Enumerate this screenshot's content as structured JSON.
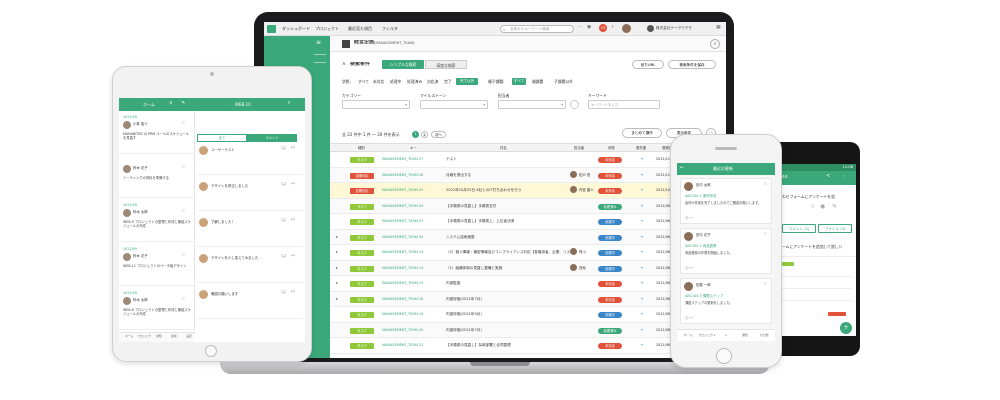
{
  "colors": {
    "brand": "#3aa87a",
    "tag": "#8fc93a",
    "red": "#e0533a",
    "blue": "#3a86c8",
    "highlight": "#fff8d6"
  },
  "laptop": {
    "nav": [
      "ダッシュボード",
      "プロジェクト",
      "最近見た項目",
      "フィルタ"
    ],
    "search_placeholder": "全体からキーワード検索",
    "notif_count": "15",
    "company": "株式会社テーラワデモ",
    "project_title": "経営企画",
    "project_code": "(MANAGEMENT_TEAM)",
    "search_section": "検索条件",
    "simple_tab": "シンプルな検索",
    "advanced_tab": "高度な検索",
    "share_btn": "絞りURL",
    "save_btn": "検索条件を保存",
    "status_label": "状態:",
    "status_opts": [
      "すべて",
      "未対応",
      "処理中",
      "処理済み",
      "対応済",
      "完了",
      "完了以外"
    ],
    "parent_label": "親子課題:",
    "parent_opts": [
      "すべて",
      "親課題",
      "子課題以外"
    ],
    "filters": [
      "カテゴリー",
      "マイルストーン",
      "担当者",
      "キーワード"
    ],
    "keyword_placeholder": "キーワードを入力",
    "result_text": "全 22 件中 1 件 〜 20 件を表示",
    "pages": [
      "1",
      "2",
      "次へ"
    ],
    "bulk_btn": "まとめて操作",
    "display_btn": "表示設定",
    "columns": [
      "種別",
      "キー",
      "件名",
      "担当者",
      "状態",
      "優先度",
      "登録日",
      "期限日",
      "更新日"
    ],
    "rows": [
      {
        "type": "タスク",
        "key": "MANAGEMENT_TEAM-27",
        "subject": "テスト",
        "assignee": "",
        "status": "未対応",
        "prio": "→",
        "date": "2021/11/02",
        "due": "",
        "updated": ""
      },
      {
        "type": "定期対応",
        "key": "MANAGEMENT_TEAM-26",
        "subject": "月報を提出する",
        "assignee": "松戸 悠",
        "status": "未対応",
        "prio": "→",
        "date": "2021/11/02",
        "due": "2021/10/31",
        "updated": "2021/"
      },
      {
        "type": "定期対応",
        "key": "MANAGEMENT_TEAM-25",
        "subject": "2021年10月25日 A社とのIT打ち合わせを行う",
        "assignee": "内室 裏人",
        "status": "未対応",
        "prio": "→",
        "date": "2021/10/22",
        "due": "2021/10/25",
        "updated": "2021/"
      },
      {
        "type": "タスク",
        "key": "MANAGEMENT_TEAM-24",
        "subject": "【手順書の見直し】手順書支付",
        "assignee": "",
        "status": "処理済み",
        "prio": "→",
        "date": "2021/08/20",
        "due": "2022/01/01",
        "updated": "2021/"
      },
      {
        "type": "タスク",
        "key": "MANAGEMENT_TEAM-23",
        "subject": "【手順書の見直し】手順書上、上位者決済",
        "assignee": "",
        "status": "処理中",
        "prio": "→",
        "date": "2021/08/20",
        "due": "2021/08/20",
        "updated": "2021/"
      },
      {
        "type": "タスク",
        "key": "MANAGEMENT_TEAM-34",
        "subject": "システム技術面整",
        "assignee": "",
        "status": "処理中",
        "prio": "→",
        "date": "2021/08/20",
        "due": "2021/08/20",
        "updated": "2021/"
      },
      {
        "type": "タスク",
        "key": "MANAGEMENT_TEAM-13",
        "subject": "（2）個人情報・機密情報及びコンプライアンス対応【各機用者、企業、リスク対策等、研修】（通年実施）",
        "assignee": "阿川",
        "status": "処理中",
        "prio": "→",
        "date": "2021/08/20",
        "due": "2022/03/30",
        "updated": "2021/"
      },
      {
        "type": "タスク",
        "key": "MANAGEMENT_TEAM-14",
        "subject": "（1）組織体制の見直し整備と実施",
        "assignee": "西地",
        "status": "処理中",
        "prio": "→",
        "date": "2021/08/20",
        "due": "2021/08/20",
        "updated": "2021/"
      },
      {
        "type": "タスク",
        "key": "MANAGEMENT_TEAM-15",
        "subject": "内部監査",
        "assignee": "",
        "status": "未対応",
        "prio": "→",
        "date": "2021/08/20",
        "due": "2021/08/20",
        "updated": "2021/"
      },
      {
        "type": "タスク",
        "key": "MANAGEMENT_TEAM-18",
        "subject": "内部評価(2021年7月)",
        "assignee": "",
        "status": "未対応",
        "prio": "→",
        "date": "2021/08/20",
        "due": "2021/08/20",
        "updated": "2021/"
      },
      {
        "type": "タスク",
        "key": "MANAGEMENT_TEAM-19",
        "subject": "内部評価(2021年9月)",
        "assignee": "",
        "status": "処理中",
        "prio": "→",
        "date": "2021/08/20",
        "due": "2021/08/20",
        "updated": "2021/"
      },
      {
        "type": "タスク",
        "key": "MANAGEMENT_TEAM-20",
        "subject": "内部評価(2021年7月)",
        "assignee": "",
        "status": "処理済み",
        "prio": "→",
        "date": "2021/08/20",
        "due": "2021/08/20",
        "updated": "2021/"
      },
      {
        "type": "タスク",
        "key": "MANAGEMENT_TEAM-21",
        "subject": "【手順書の見直し】採用部署と合同整理",
        "assignee": "",
        "status": "未対応",
        "prio": "→",
        "date": "2021/08/20",
        "due": "2021/08/20",
        "updated": "2021/"
      }
    ]
  },
  "tablet": {
    "left_title": "ホーム",
    "right_title": "WEB-10",
    "entries": [
      {
        "date": "2021/09",
        "name": "小林 俊介",
        "text": "MANABITED の PRM ルールのスケジュールを見直す"
      },
      {
        "date": "",
        "name": "鈴木 花子",
        "text": "ミーティングの資料を準備する"
      },
      {
        "date": "2021/09",
        "name": "鈴木 太郎",
        "text": "WEB-9 プロジェクトの整理と作成と審議スケジュールの作成"
      },
      {
        "date": "2021/09",
        "name": "鈴木 花子",
        "text": "WEB-11 プロジェクトのベータ版デザイン"
      },
      {
        "date": "2021/09",
        "name": "鈴木 太郎",
        "text": "WEB-8 プロジェクトの整理と作成と審議スケジュールの作成"
      }
    ],
    "detail_tabs": [
      "全て",
      "コメント"
    ],
    "comments": [
      "ユーザーテスト",
      "デザインを修正しました",
      "了解しました！",
      "デザインを少し変えてみました",
      "確認お願いします"
    ],
    "bottom_nav": [
      "ホーム",
      "プロジェクト",
      "通知",
      "検索",
      "設定"
    ]
  },
  "phone": {
    "header": "最近の更新",
    "items": [
      {
        "user": "田中 太郎",
        "key": "ABC100-1 素材作成",
        "text": "素材の作成を完了しましたのでご確認お願いします。"
      },
      {
        "user": "田中 花子",
        "key": "ABC100-2 商品登録",
        "text": "商品登録の作業を開始しました。"
      },
      {
        "user": "佐藤 一郎",
        "key": "ABC100-3 課題ステップ",
        "text": "課題ステップの更新をしました。"
      }
    ],
    "bottom_nav": [
      "ホーム",
      "プロジェクト",
      "+",
      "通知",
      "その他"
    ]
  },
  "android": {
    "time": "11:08",
    "title": "44",
    "text1": "わせフォームにアンケートを追",
    "btn1": "コメント (2)",
    "btn2": "ファイル (0)",
    "text2": "ームにアンケートを追加して欲しい"
  }
}
